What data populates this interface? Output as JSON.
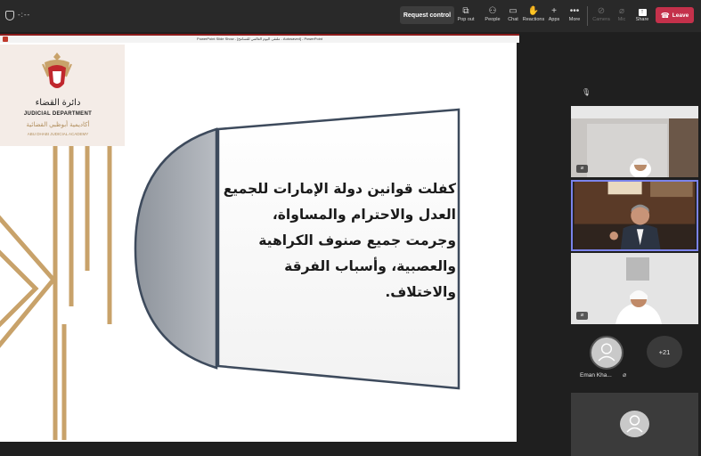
{
  "topbar": {
    "timer": "-:--",
    "request_control_label": "Request control",
    "buttons": [
      {
        "label": "Pop out",
        "icon": "pop-out-icon"
      },
      {
        "label": "People",
        "icon": "people-icon"
      },
      {
        "label": "Chat",
        "icon": "chat-icon"
      },
      {
        "label": "Reactions",
        "icon": "reactions-icon"
      },
      {
        "label": "Apps",
        "icon": "apps-icon"
      },
      {
        "label": "More",
        "icon": "more-icon"
      },
      {
        "label": "Camera",
        "icon": "camera-icon"
      },
      {
        "label": "Mic",
        "icon": "mic-icon"
      },
      {
        "label": "Share",
        "icon": "share-icon"
      }
    ],
    "leave_label": "Leave"
  },
  "shared_window": {
    "title": "PowerPoint Slide Show - [ملتقى اليوم العالمي للتسامح - Autosaved] - PowerPoint",
    "slide": {
      "logo_arabic": "دائرة القضاء",
      "logo_english": "JUDICIAL DEPARTMENT",
      "logo_arabic_academy": "أكاديمية أبوظبي القضائية",
      "logo_english_academy": "ABU DHABI JUDICIAL ACADEMY",
      "quote": "كفلت قوانين دولة الإمارات للجميع العدل والاحترام والمساواة، وجرمت جميع صنوف الكراهية والعصبية، وأسباب الفرقة والاختلاف."
    }
  },
  "gallery": {
    "more_participants": "+21",
    "participant_name": "Eman Kha..."
  },
  "colors": {
    "leave": "#c4314b",
    "active_speaker_border": "#7b83eb",
    "slide_disc": "#a3a8b0",
    "slide_gold": "#c8a26a"
  }
}
